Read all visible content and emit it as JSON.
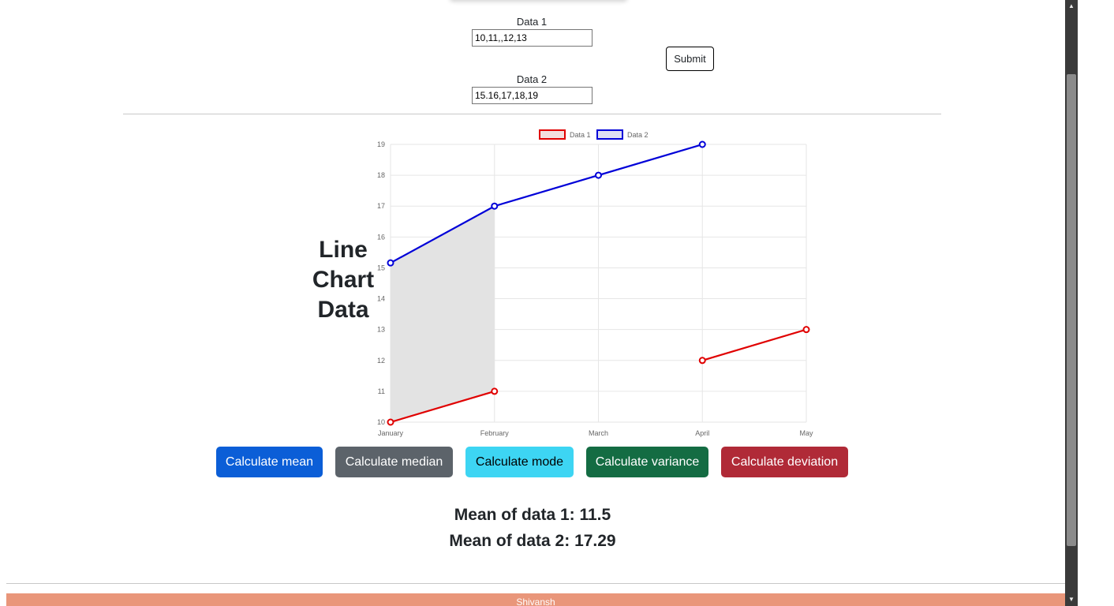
{
  "form": {
    "data1_label": "Data 1",
    "data1_value": "10,11,,12,13",
    "data2_label": "Data 2",
    "data2_value": "15.16,17,18,19",
    "submit_label": "Submit"
  },
  "chart_heading": [
    "Line",
    "Chart",
    "Data"
  ],
  "chart_data": {
    "type": "line",
    "categories": [
      "January",
      "February",
      "March",
      "April",
      "May"
    ],
    "series": [
      {
        "name": "Data 1",
        "values": [
          10,
          11,
          null,
          12,
          13
        ],
        "color": "#e00000",
        "fill": false
      },
      {
        "name": "Data 2",
        "values": [
          15.16,
          17,
          18,
          19,
          null
        ],
        "color": "#0000d8",
        "fill": true
      }
    ],
    "y_ticks": [
      10,
      11,
      12,
      13,
      14,
      15,
      16,
      17,
      18,
      19
    ],
    "ylim": [
      10,
      19
    ],
    "grid": true,
    "legend": "top",
    "fill_color": "#e3e3e3"
  },
  "buttons": [
    {
      "label": "Calculate mean",
      "color": "#0b5ed7"
    },
    {
      "label": "Calculate median",
      "color": "#5c636a"
    },
    {
      "label": "Calculate mode",
      "color": "#3dd5f3"
    },
    {
      "label": "Calculate variance",
      "color": "#146c43"
    },
    {
      "label": "Calculate deviation",
      "color": "#b02a37"
    }
  ],
  "results": {
    "mean1": "Mean of data 1: 11.5",
    "mean2": "Mean of data 2: 17.29"
  },
  "footer": {
    "text": "Shivansh",
    "color": "#e9967a"
  }
}
